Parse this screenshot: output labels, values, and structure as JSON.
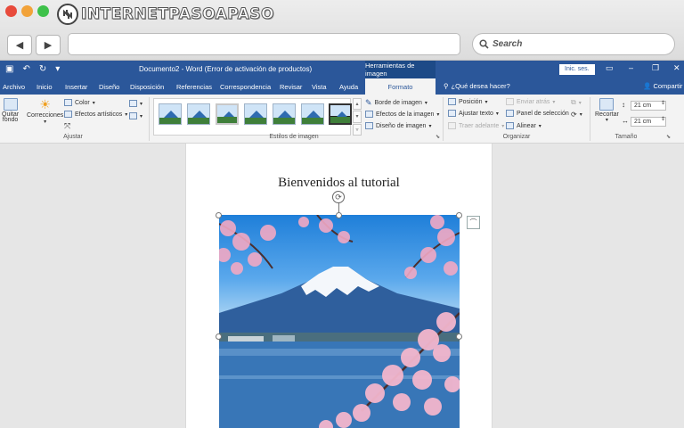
{
  "browser": {
    "brand_name": "INTERNETPASOAPASO",
    "url": "",
    "search_placeholder": "Search",
    "traffic_colors": [
      "#e84b3c",
      "#f2a33a",
      "#3ec14a"
    ],
    "back_icon": "back-arrow-icon",
    "forward_icon": "forward-arrow-icon"
  },
  "word": {
    "accent": "#2b579a",
    "document_title": "Documento2 - Word (Error de activación de productos)",
    "context_tab_group": "Herramientas de imagen",
    "sign_in": "Inic. ses.",
    "tabs": [
      "Archivo",
      "Inicio",
      "Insertar",
      "Diseño",
      "Disposición",
      "Referencias",
      "Correspondencia",
      "Revisar",
      "Vista",
      "Ayuda",
      "Formato"
    ],
    "active_tab": "Formato",
    "tell_me": "¿Qué desea hacer?",
    "share": "Compartir"
  },
  "ribbon": {
    "ajustar": {
      "label": "Ajustar",
      "remove_bg": [
        "Quitar",
        "fondo"
      ],
      "corrections": "Correcciones",
      "color": "Color",
      "artistic": "Efectos artísticos"
    },
    "styles": {
      "label": "Estilos de imagen",
      "border": "Borde de imagen",
      "effects": "Efectos de la imagen",
      "layout": "Diseño de imagen"
    },
    "organizar": {
      "label": "Organizar",
      "position": "Posición",
      "wrap": "Ajustar texto",
      "forward": "Traer adelante",
      "backward": "Enviar atrás",
      "selection_pane": "Panel de selección",
      "align": "Alinear"
    },
    "tamano": {
      "label": "Tamaño",
      "crop": "Recortar",
      "height": "21 cm",
      "width": "21 cm"
    }
  },
  "document": {
    "heading": "Bienvenidos al tutorial"
  }
}
